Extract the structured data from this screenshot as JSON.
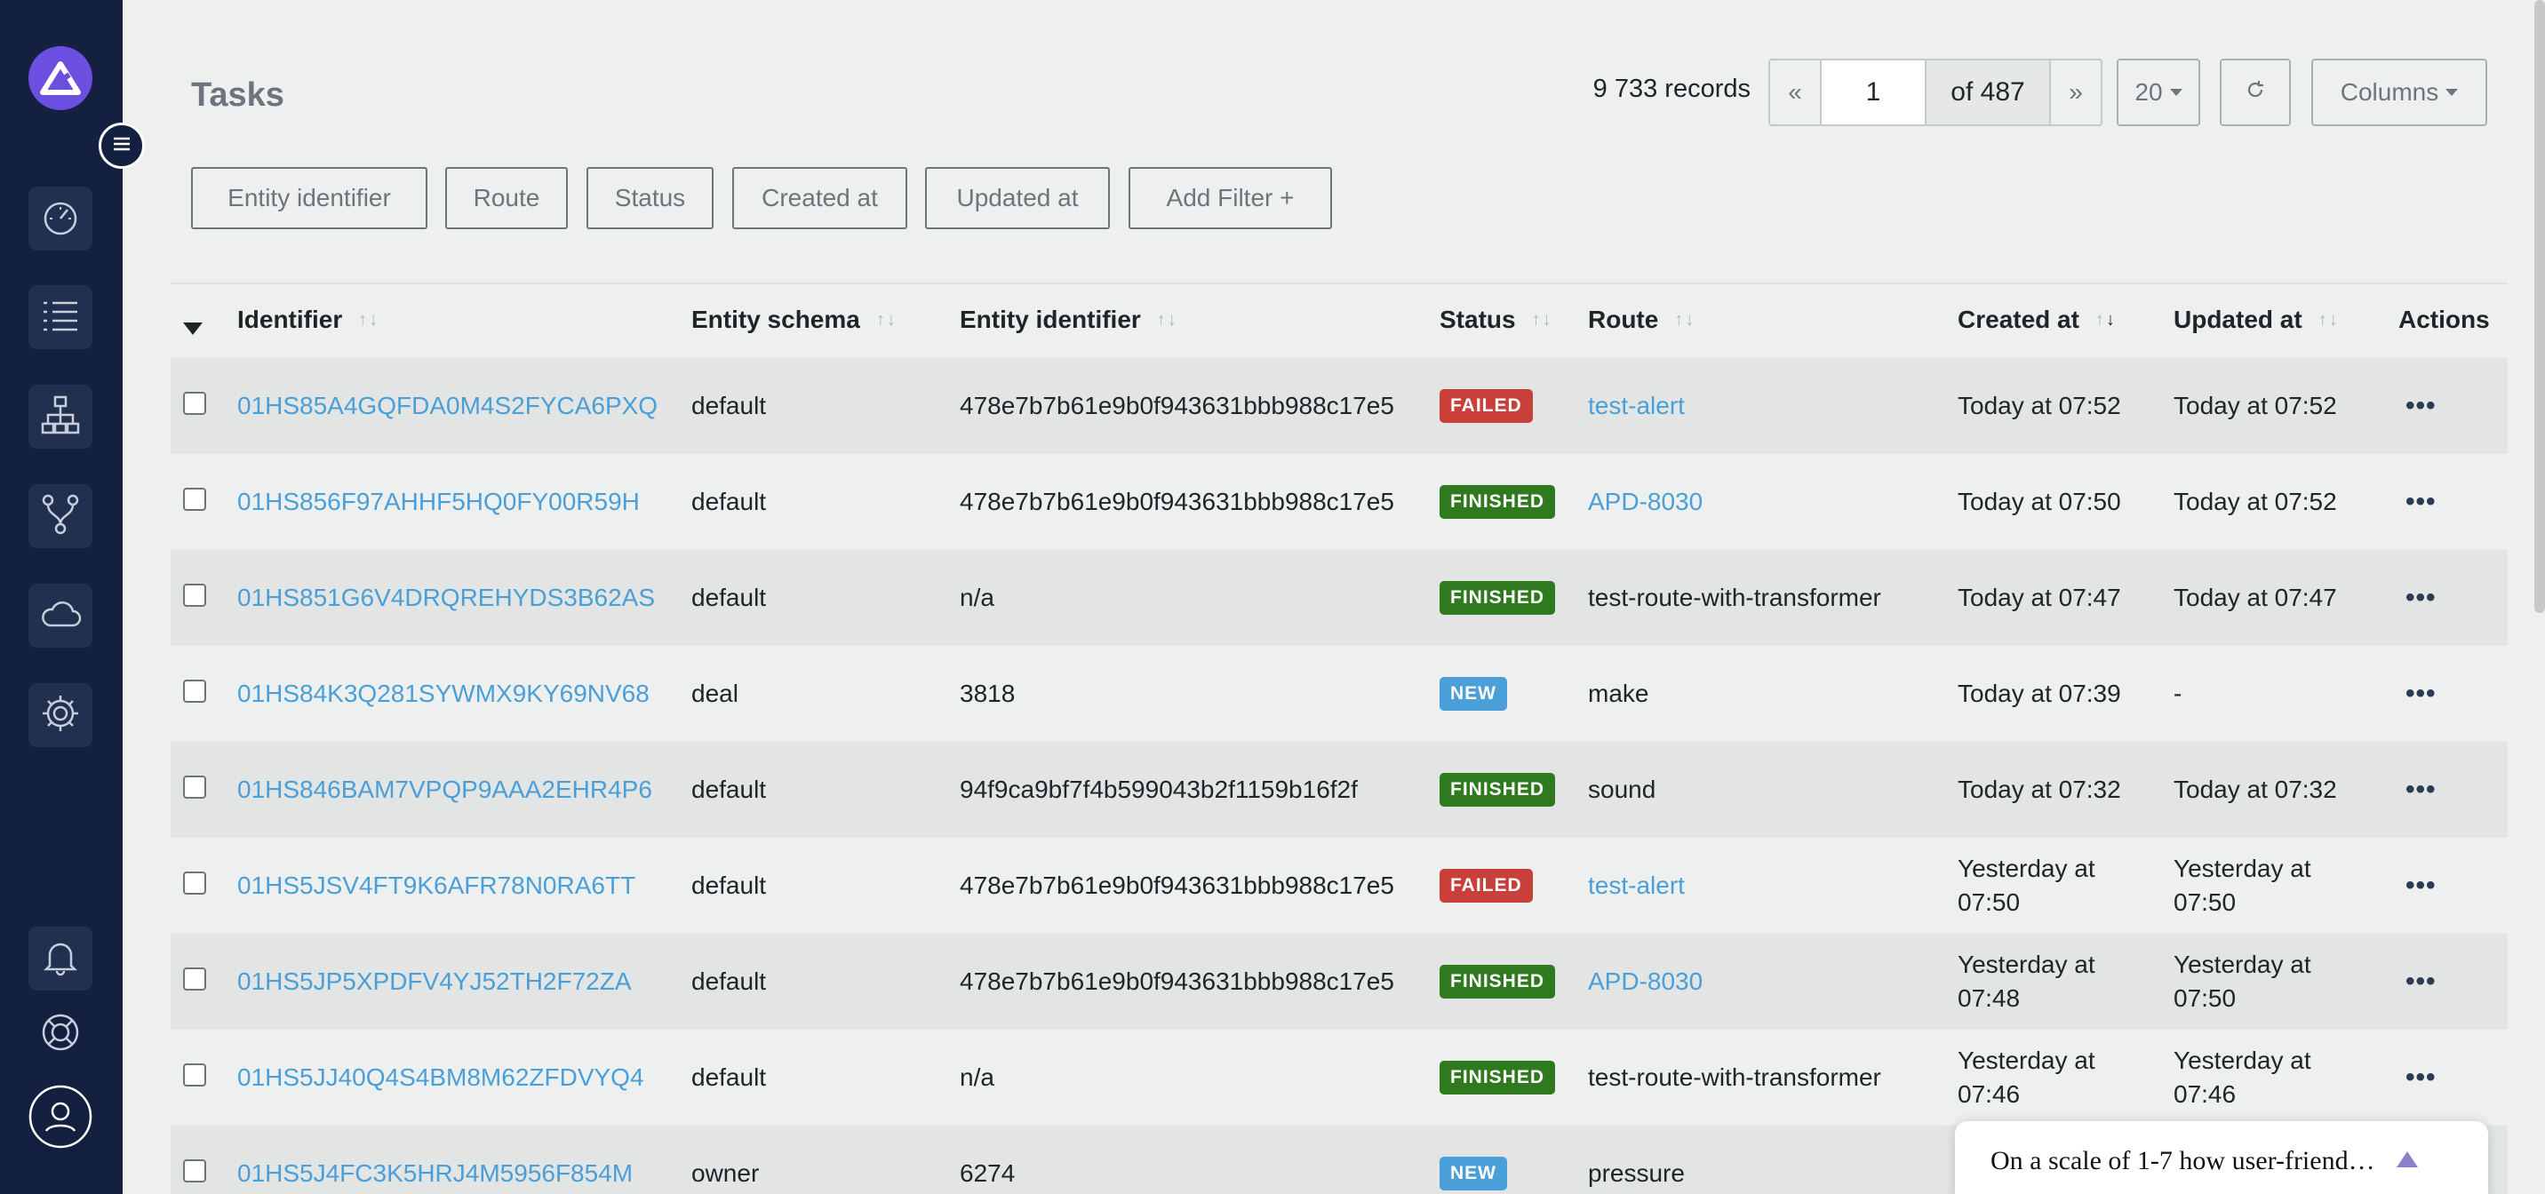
{
  "sidebar": {
    "toggle_icon": "menu-icon",
    "items": [
      {
        "name": "dashboard",
        "icon": "gauge-icon"
      },
      {
        "name": "tasks",
        "icon": "list-icon"
      },
      {
        "name": "schemas",
        "icon": "hierarchy-icon"
      },
      {
        "name": "routes",
        "icon": "branch-icon"
      },
      {
        "name": "cloud",
        "icon": "cloud-icon"
      },
      {
        "name": "settings",
        "icon": "gear-icon"
      }
    ],
    "bottom": [
      {
        "name": "notifications",
        "icon": "bell-icon"
      },
      {
        "name": "help",
        "icon": "lifebuoy-icon"
      },
      {
        "name": "profile",
        "icon": "user-icon"
      }
    ]
  },
  "header": {
    "title": "Tasks",
    "records": "9 733 records",
    "pager": {
      "first": "«",
      "page": "1",
      "of": "of 487",
      "next": "»"
    },
    "page_size": "20",
    "refresh_icon": "refresh-icon",
    "columns_label": "Columns"
  },
  "filters": [
    "Entity identifier",
    "Route",
    "Status",
    "Created at",
    "Updated at",
    "Add Filter +"
  ],
  "table": {
    "columns": [
      "Identifier",
      "Entity schema",
      "Entity identifier",
      "Status",
      "Route",
      "Created at",
      "Updated at",
      "Actions"
    ],
    "sort_glyph": "↑↓",
    "rows": [
      {
        "id": "01HS85A4GQFDA0M4S2FYCA6PXQ",
        "schema": "default",
        "entity": "478e7b7b61e9b0f943631bbb988c17e5",
        "status": "FAILED",
        "route": "test-alert",
        "route_link": true,
        "created": "Today at 07:52",
        "updated": "Today at 07:52"
      },
      {
        "id": "01HS856F97AHHF5HQ0FY00R59H",
        "schema": "default",
        "entity": "478e7b7b61e9b0f943631bbb988c17e5",
        "status": "FINISHED",
        "route": "APD-8030",
        "route_link": true,
        "created": "Today at 07:50",
        "updated": "Today at 07:52"
      },
      {
        "id": "01HS851G6V4DRQREHYDS3B62AS",
        "schema": "default",
        "entity": "n/a",
        "status": "FINISHED",
        "route": "test-route-with-transformer",
        "route_link": false,
        "created": "Today at 07:47",
        "updated": "Today at 07:47"
      },
      {
        "id": "01HS84K3Q281SYWMX9KY69NV68",
        "schema": "deal",
        "entity": "3818",
        "status": "NEW",
        "route": "make",
        "route_link": false,
        "created": "Today at 07:39",
        "updated": "-"
      },
      {
        "id": "01HS846BAM7VPQP9AAA2EHR4P6",
        "schema": "default",
        "entity": "94f9ca9bf7f4b599043b2f1159b16f2f",
        "status": "FINISHED",
        "route": "sound",
        "route_link": false,
        "created": "Today at 07:32",
        "updated": "Today at 07:32"
      },
      {
        "id": "01HS5JSV4FT9K6AFR78N0RA6TT",
        "schema": "default",
        "entity": "478e7b7b61e9b0f943631bbb988c17e5",
        "status": "FAILED",
        "route": "test-alert",
        "route_link": true,
        "created": "Yesterday at 07:50",
        "updated": "Yesterday at 07:50"
      },
      {
        "id": "01HS5JP5XPDFV4YJ52TH2F72ZA",
        "schema": "default",
        "entity": "478e7b7b61e9b0f943631bbb988c17e5",
        "status": "FINISHED",
        "route": "APD-8030",
        "route_link": true,
        "created": "Yesterday at 07:48",
        "updated": "Yesterday at 07:50"
      },
      {
        "id": "01HS5JJ40Q4S4BM8M62ZFDVYQ4",
        "schema": "default",
        "entity": "n/a",
        "status": "FINISHED",
        "route": "test-route-with-transformer",
        "route_link": false,
        "created": "Yesterday at 07:46",
        "updated": "Yesterday at 07:46"
      },
      {
        "id": "01HS5J4FC3K5HRJ4M5956F854M",
        "schema": "owner",
        "entity": "6274",
        "status": "NEW",
        "route": "pressure",
        "route_link": false,
        "created": "",
        "updated": ""
      }
    ],
    "actions_glyph": "•••"
  },
  "status_colors": {
    "FAILED": "#c9403a",
    "FINISHED": "#2f7a1f",
    "NEW": "#4a9fd8"
  },
  "feedback": {
    "text": "On a scale of 1-7 how user-friend…"
  }
}
